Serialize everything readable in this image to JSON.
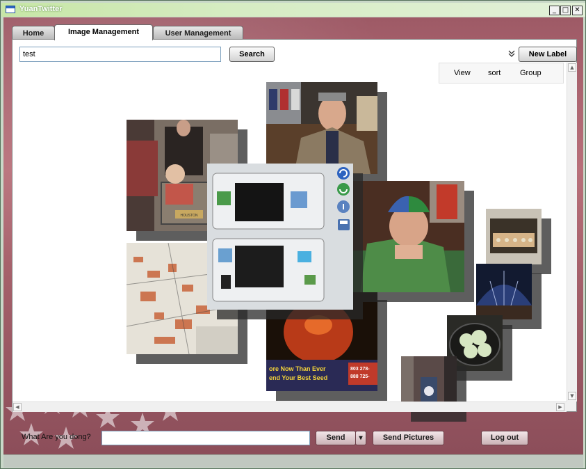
{
  "window": {
    "title": "YuanTwitter",
    "minimize": "_",
    "maximize": "□",
    "close": "✕"
  },
  "tabs": [
    {
      "label": "Home",
      "active": false
    },
    {
      "label": "Image Management",
      "active": true
    },
    {
      "label": "User Management",
      "active": false
    }
  ],
  "search": {
    "value": "test",
    "button": "Search"
  },
  "toolbar": {
    "new_label": "New Label",
    "expand_icon": "chevron-double-down-icon"
  },
  "options": {
    "view": "View",
    "sort": "sort",
    "group": "Group"
  },
  "image_actions": [
    "refresh-icon",
    "rotate-icon",
    "info-icon",
    "save-icon"
  ],
  "status": {
    "prompt": "What Are you dong?",
    "value": "",
    "send": "Send",
    "send_dropdown": "▾",
    "send_pictures": "Send Pictures",
    "logout": "Log out"
  },
  "photo_text": {
    "tv_caption": "ore Now Than Ever\nend Your Best Seed",
    "tv_number": "803 278-\n888 725-",
    "cart_sign": "HOUSTON"
  },
  "colors": {
    "accent_blue": "#2d63c0",
    "titlebar_green": "#c7e6a6",
    "background_maroon": "#a4606a"
  }
}
